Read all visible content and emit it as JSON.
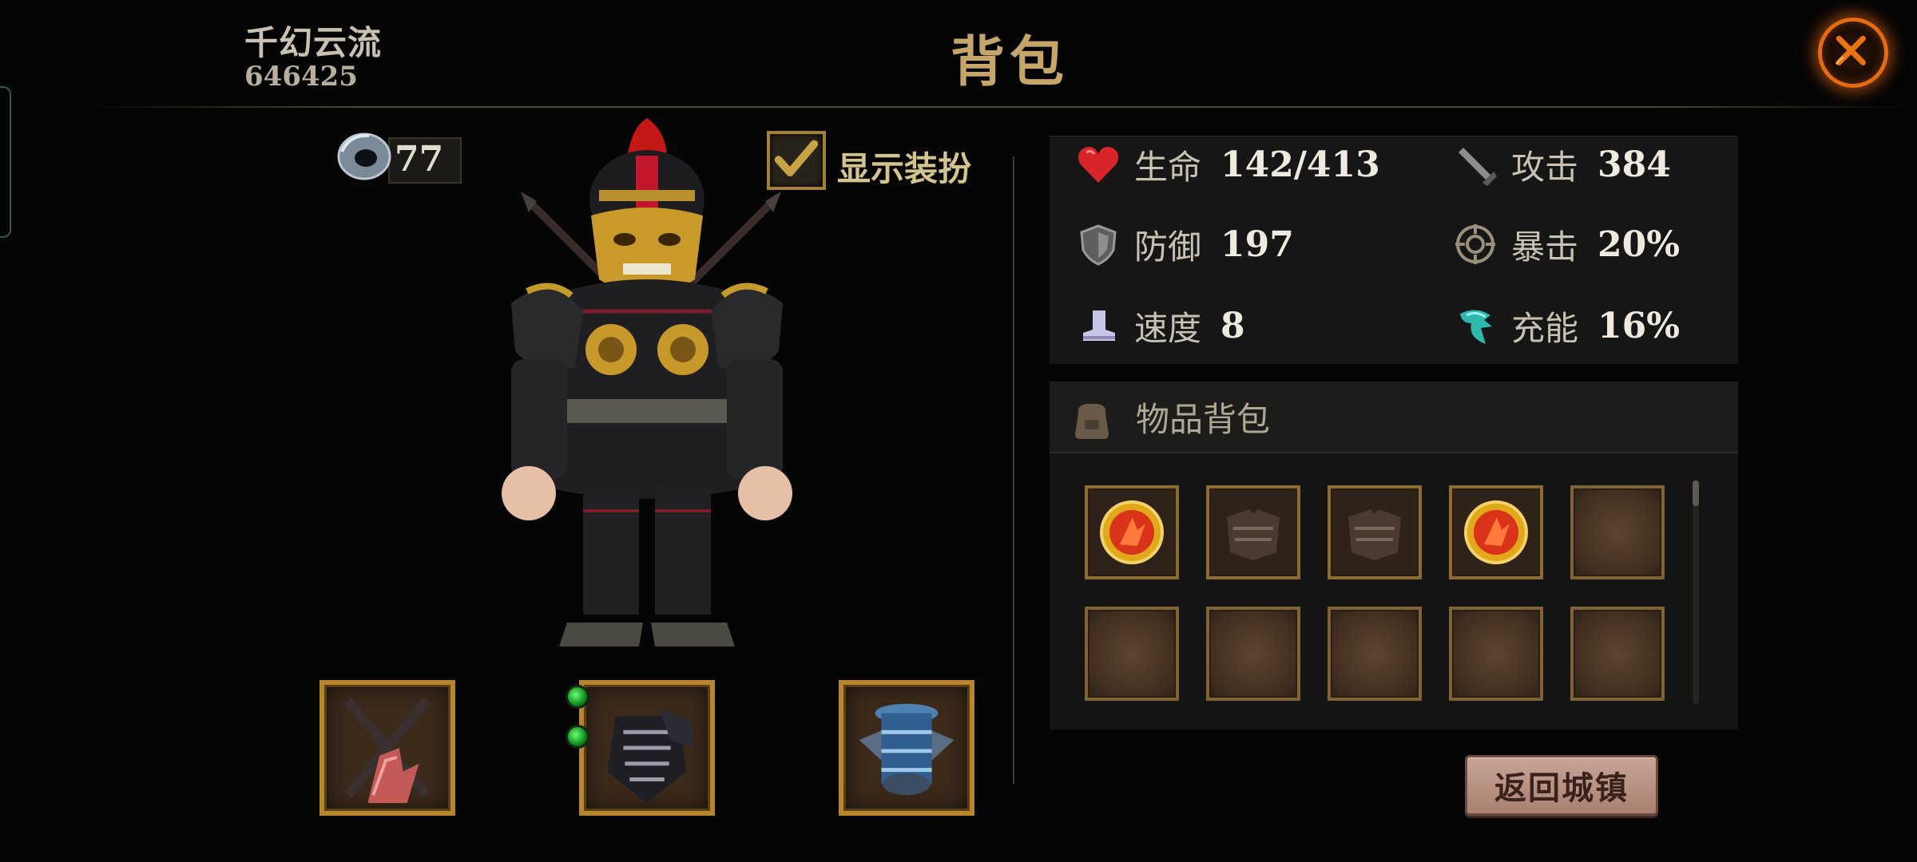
{
  "header": {
    "player_name": "千幻云流",
    "player_id": "646425",
    "title": "背包"
  },
  "currency": {
    "icon": "ring-icon",
    "value": "77"
  },
  "costume_toggle": {
    "label": "显示装扮",
    "checked": true
  },
  "stats": [
    {
      "key": "hp",
      "icon": "heart-icon",
      "label": "生命",
      "value": "142/413"
    },
    {
      "key": "attack",
      "icon": "sword-icon",
      "label": "攻击",
      "value": "384"
    },
    {
      "key": "defense",
      "icon": "shield-icon",
      "label": "防御",
      "value": "197"
    },
    {
      "key": "crit",
      "icon": "crit-icon",
      "label": "暴击",
      "value": "20%"
    },
    {
      "key": "speed",
      "icon": "boot-icon",
      "label": "速度",
      "value": "8"
    },
    {
      "key": "charge",
      "icon": "charge-icon",
      "label": "充能",
      "value": "16%"
    }
  ],
  "inventory": {
    "title": "物品背包",
    "slots": [
      {
        "item": "fire-coin"
      },
      {
        "item": "dark-armor"
      },
      {
        "item": "dark-armor"
      },
      {
        "item": "fire-coin"
      },
      {
        "item": "empty"
      },
      {
        "item": "empty"
      },
      {
        "item": "empty"
      },
      {
        "item": "empty"
      },
      {
        "item": "empty"
      },
      {
        "item": "empty"
      }
    ]
  },
  "equipment": [
    {
      "slot": "weapon",
      "icon": "crossed-blades-icon"
    },
    {
      "slot": "armor",
      "icon": "armor-icon",
      "gem_sockets": 2
    },
    {
      "slot": "accessory",
      "icon": "blue-armor-icon"
    }
  ],
  "return_button": {
    "label": "返回城镇"
  },
  "colors": {
    "gold": "#b7862c",
    "close_glow": "#e36b10",
    "title": "#c6a56b",
    "hp_heart": "#d9242a",
    "charge": "#2fb8b0"
  }
}
